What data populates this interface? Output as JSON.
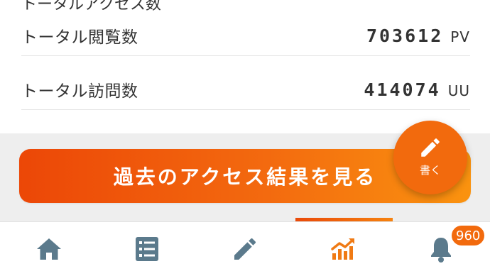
{
  "stats": {
    "cut_heading": "トータルアクセス数",
    "rows": [
      {
        "label": "トータル閲覧数",
        "value": "703612",
        "unit": "PV"
      },
      {
        "label": "トータル訪問数",
        "value": "414074",
        "unit": "UU"
      }
    ]
  },
  "past_access_button": {
    "label": "過去のアクセス結果を見る"
  },
  "write_fab": {
    "label": "書く",
    "icon": "pencil-icon"
  },
  "bottom_nav": {
    "items": [
      {
        "name": "home",
        "icon": "home-icon",
        "active": false
      },
      {
        "name": "list",
        "icon": "list-icon",
        "active": false
      },
      {
        "name": "write",
        "icon": "pencil-icon",
        "active": false
      },
      {
        "name": "access",
        "icon": "chart-icon",
        "active": true
      },
      {
        "name": "notifications",
        "icon": "bell-icon",
        "active": false
      }
    ],
    "notification_count": "960"
  },
  "colors": {
    "accent": "#f26a0d",
    "nav_icon": "#5b7a8c",
    "gradient_start": "#ec4707",
    "gradient_end": "#fa930f"
  }
}
